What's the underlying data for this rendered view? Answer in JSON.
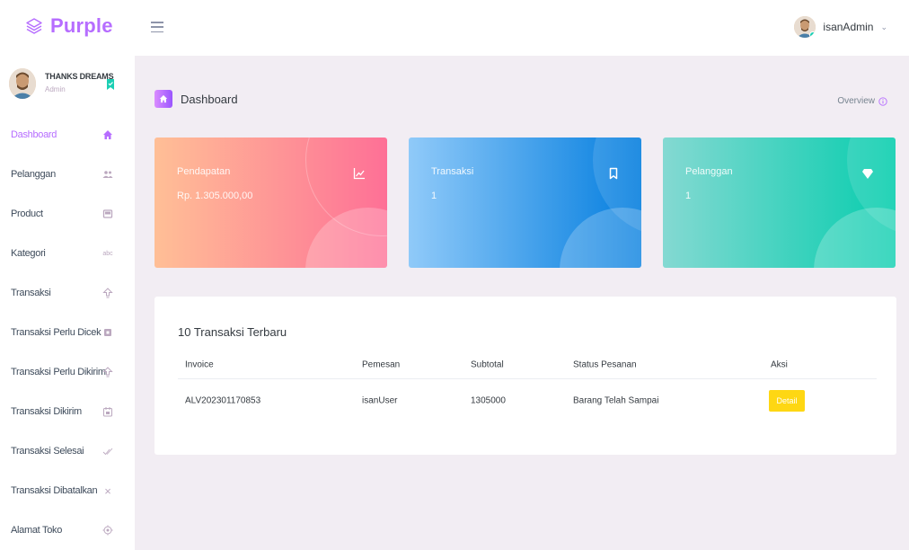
{
  "brand": {
    "name": "Purple",
    "color": "#b66dff"
  },
  "navbar": {
    "user_name": "isanAdmin",
    "chevron": "⌄"
  },
  "sidebar": {
    "profile": {
      "name": "THANKS DREAMS",
      "role": "Admin"
    },
    "items": [
      {
        "label": "Dashboard",
        "icon": "home-icon",
        "active": true
      },
      {
        "label": "Pelanggan",
        "icon": "users-icon"
      },
      {
        "label": "Product",
        "icon": "package-icon"
      },
      {
        "label": "Kategori",
        "icon": "abc-icon",
        "glyph": "abc"
      },
      {
        "label": "Transaksi",
        "icon": "upload-arrow-icon"
      },
      {
        "label": "Transaksi Perlu Dicek",
        "icon": "square-icon"
      },
      {
        "label": "Transaksi Perlu Dikirim",
        "icon": "upload-arrow-icon"
      },
      {
        "label": "Transaksi Dikirim",
        "icon": "calendar-icon"
      },
      {
        "label": "Transaksi Selesai",
        "icon": "check-all-icon"
      },
      {
        "label": "Transaksi Dibatalkan",
        "icon": "close-icon",
        "glyph": "×"
      },
      {
        "label": "Alamat Toko",
        "icon": "crosshair-icon"
      }
    ]
  },
  "page": {
    "title": "Dashboard",
    "overview_label": "Overview"
  },
  "cards": [
    {
      "title": "Pendapatan",
      "value": "Rp. 1.305.000,00",
      "icon": "chart-line-icon"
    },
    {
      "title": "Transaksi",
      "value": "1",
      "icon": "bookmark-icon"
    },
    {
      "title": "Pelanggan",
      "value": "1",
      "icon": "diamond-icon"
    }
  ],
  "table": {
    "title": "10 Transaksi Terbaru",
    "headers": {
      "invoice": "Invoice",
      "pemesan": "Pemesan",
      "subtotal": "Subtotal",
      "status": "Status Pesanan",
      "aksi": "Aksi"
    },
    "rows": [
      {
        "invoice": "ALV202301170853",
        "pemesan": "isanUser",
        "subtotal": "1305000",
        "status": "Barang Telah Sampai",
        "action_label": "Detail"
      }
    ]
  },
  "colors": {
    "accent": "#b66dff",
    "detail_button": "#fed713",
    "card_danger": [
      "#ffbf96",
      "#fe7096"
    ],
    "card_info": [
      "#90caf9",
      "#047edf"
    ],
    "card_success": [
      "#84d9d2",
      "#07cdae"
    ]
  }
}
